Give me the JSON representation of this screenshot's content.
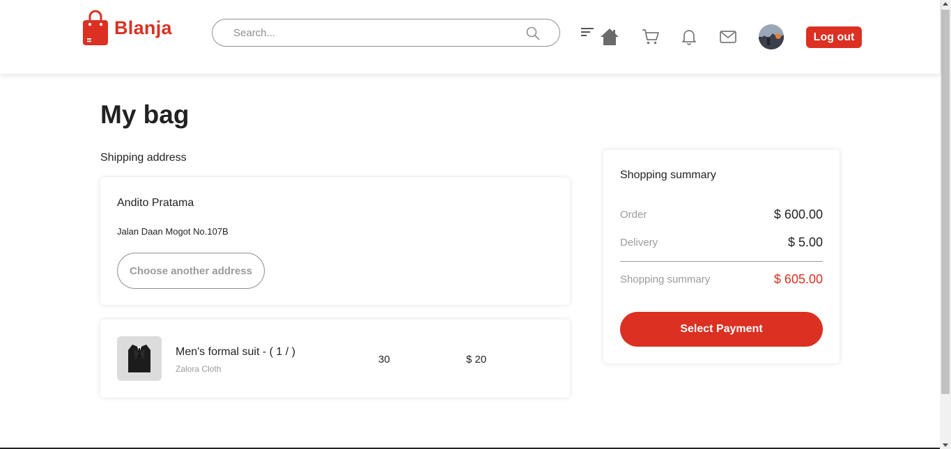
{
  "header": {
    "brand": "Blanja",
    "search_placeholder": "Search...",
    "logout_label": "Log out"
  },
  "colors": {
    "accent": "#db3022",
    "muted_text": "#9b9b9b"
  },
  "icons": [
    "bag-logo-icon",
    "search-icon",
    "filter-icon",
    "home-icon",
    "cart-icon",
    "bell-icon",
    "mail-icon"
  ],
  "page": {
    "title": "My bag",
    "shipping_label": "Shipping address"
  },
  "address": {
    "name": "Andito Pratama",
    "line": "Jalan Daan Mogot No.107B",
    "choose_label": "Choose another address"
  },
  "items": [
    {
      "name": "Men's formal suit  -  ( 1 / )",
      "store": "Zalora Cloth",
      "quantity": "30",
      "price": "$ 20"
    }
  ],
  "summary": {
    "title": "Shopping summary",
    "order_label": "Order",
    "order_value": "$ 600.00",
    "delivery_label": "Delivery",
    "delivery_value": "$ 5.00",
    "total_label": "Shopping summary",
    "total_value": "$ 605.00",
    "pay_label": "Select Payment"
  }
}
